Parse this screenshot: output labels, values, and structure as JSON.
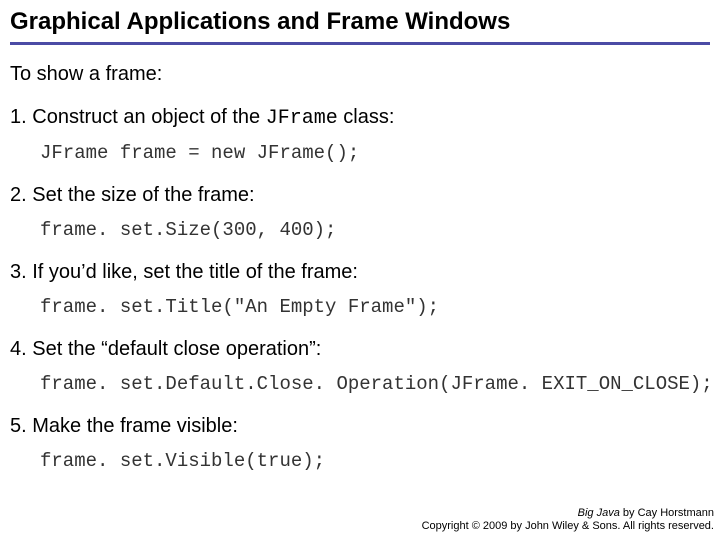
{
  "title": "Graphical Applications and Frame Windows",
  "intro": "To show a frame:",
  "steps": [
    {
      "text_pre": "Construct an object of the ",
      "inline_code": "JFrame",
      "text_post": " class:",
      "code": "JFrame frame = new JFrame();"
    },
    {
      "text_pre": "Set the size of the frame:",
      "inline_code": "",
      "text_post": "",
      "code": "frame. set.Size(300, 400);"
    },
    {
      "text_pre": "If you’d like, set the title of the frame:",
      "inline_code": "",
      "text_post": "",
      "code": "frame. set.Title(\"An Empty Frame\");"
    },
    {
      "text_pre": "Set the “default close operation”:",
      "inline_code": "",
      "text_post": "",
      "code": "frame. set.Default.Close. Operation(JFrame. EXIT_ON_CLOSE);"
    },
    {
      "text_pre": "Make the frame visible:",
      "inline_code": "",
      "text_post": "",
      "code": "frame. set.Visible(true);"
    }
  ],
  "footer": {
    "book": "Big Java",
    "byline": " by Cay Horstmann",
    "copyright": "Copyright © 2009 by John Wiley & Sons.  All rights reserved."
  }
}
